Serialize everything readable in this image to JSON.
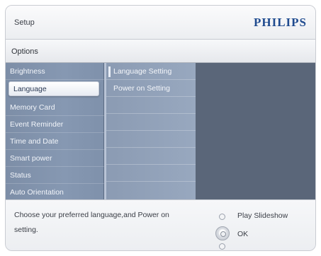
{
  "header": {
    "title": "Setup",
    "brand": "PHILIPS"
  },
  "options": {
    "label": "Options"
  },
  "menu": {
    "items": [
      {
        "label": "Brightness"
      },
      {
        "label": "Language",
        "selected": true
      },
      {
        "label": "Memory Card"
      },
      {
        "label": "Event Reminder"
      },
      {
        "label": "Time and Date"
      },
      {
        "label": "Smart power"
      },
      {
        "label": "Status"
      },
      {
        "label": "Auto Orientation"
      }
    ]
  },
  "submenu": {
    "items": [
      {
        "label": "Language Setting"
      },
      {
        "label": "Power on Setting"
      }
    ]
  },
  "footer": {
    "description": "Choose your preferred language,and Power on setting.",
    "actions": [
      {
        "label": "Play Slideshow"
      },
      {
        "label": "OK",
        "selected": true
      },
      {
        "label": ""
      }
    ]
  },
  "colors": {
    "brand": "#1f4b8f",
    "menu_background": "#8698b2",
    "panel_background": "#5a6679"
  }
}
